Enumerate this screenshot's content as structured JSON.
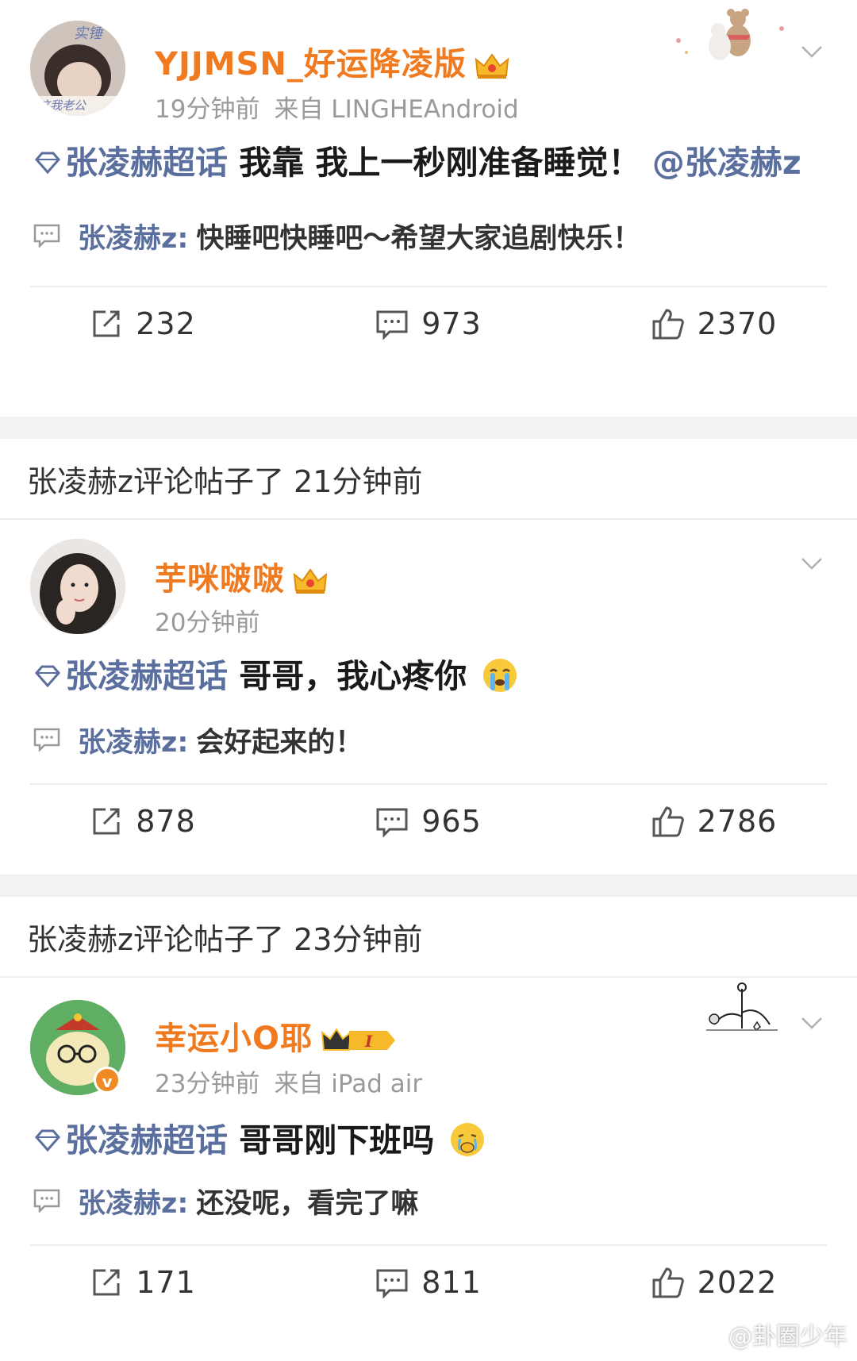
{
  "posts": [
    {
      "username": "YJJMSN_好运降凌版",
      "time": "19分钟前",
      "source": "来自 LINGHEAndroid",
      "topic": "张凌赫超话",
      "text": " 我靠 我上一秒刚准备睡觉！",
      "mention": "@张凌赫z",
      "reply_name": "张凌赫z:",
      "reply_text": "快睡吧快睡吧～希望大家追剧快乐！",
      "reposts": "232",
      "comments": "973",
      "likes": "2370"
    },
    {
      "username": "芋咪啵啵",
      "time": "20分钟前",
      "source": "",
      "topic": "张凌赫超话",
      "text": " 哥哥，我心疼你",
      "reply_name": "张凌赫z:",
      "reply_text": "会好起来的！",
      "reposts": "878",
      "comments": "965",
      "likes": "2786"
    },
    {
      "username": "幸运小O耶",
      "time": "23分钟前",
      "source": "来自 iPad air",
      "topic": "张凌赫超话",
      "text": " 哥哥刚下班吗",
      "reply_name": "张凌赫z:",
      "reply_text": "还没呢，看完了嘛",
      "reposts": "171",
      "comments": "811",
      "likes": "2022"
    }
  ],
  "notices": [
    "张凌赫z评论帖子了 21分钟前",
    "张凌赫z评论帖子了 23分钟前"
  ],
  "watermark": "@卦圈少年",
  "colors": {
    "username": "#f07a1f",
    "topic": "#5b6f9e",
    "meta": "#9a9a9a",
    "separator": "#f2f2f2"
  }
}
